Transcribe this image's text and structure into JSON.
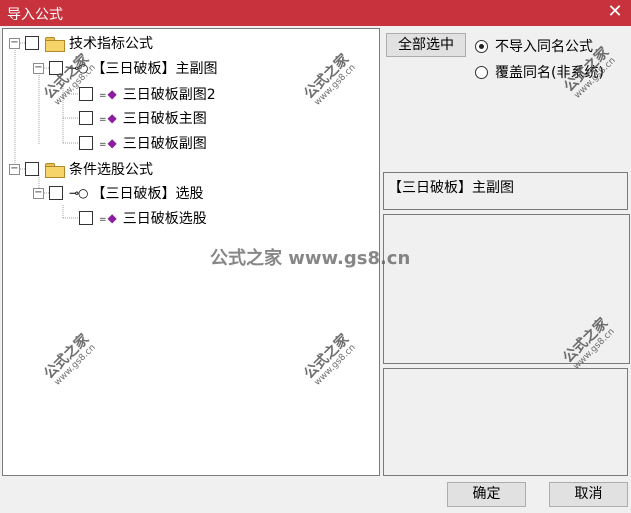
{
  "window": {
    "title": "导入公式",
    "close_glyph": "✕"
  },
  "tree": {
    "items": [
      {
        "label": "技术指标公式",
        "type": "folder"
      },
      {
        "label": "【三日破板】主副图",
        "type": "group"
      },
      {
        "label": "三日破板副图2",
        "type": "formula"
      },
      {
        "label": "三日破板主图",
        "type": "formula"
      },
      {
        "label": "三日破板副图",
        "type": "formula"
      },
      {
        "label": "条件选股公式",
        "type": "folder"
      },
      {
        "label": "【三日破板】选股",
        "type": "group"
      },
      {
        "label": "三日破板选股",
        "type": "formula"
      }
    ],
    "expander_glyph": "−"
  },
  "controls": {
    "select_all_label": "全部选中",
    "radio_skip_label": "不导入同名公式",
    "radio_overwrite_label": "覆盖同名(非系统)",
    "selected_radio": "skip"
  },
  "selected_name": "【三日破板】主副图",
  "buttons": {
    "ok_label": "确定",
    "cancel_label": "取消"
  },
  "watermark": {
    "text": "公式之家",
    "url": "www.gs8.cn",
    "center_text": "公式之家 www.gs8.cn"
  },
  "icons": {
    "folder": "folder-icon",
    "key": "key-icon",
    "gem": "gem-icon",
    "close": "close-icon"
  },
  "colors": {
    "titlebar": "#c8323c",
    "gem": "#8b1e9e"
  }
}
